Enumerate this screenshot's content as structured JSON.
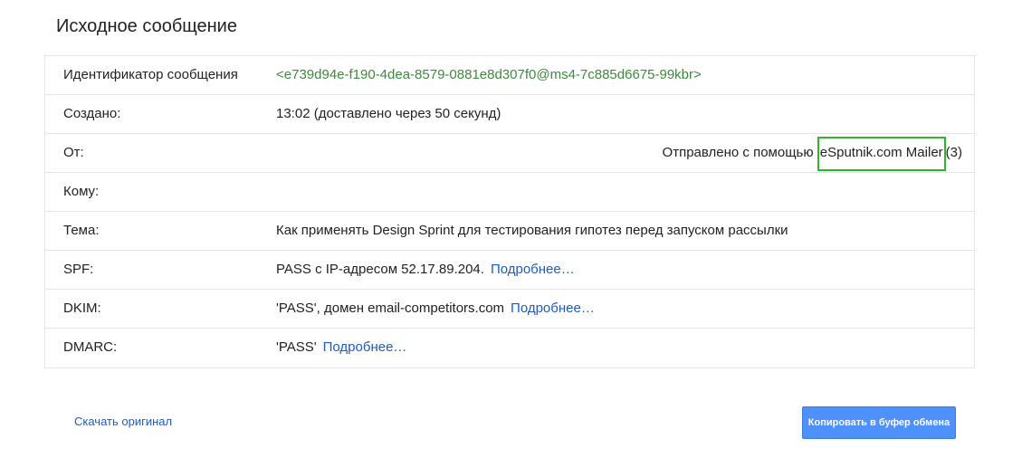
{
  "page": {
    "title": "Исходное сообщение"
  },
  "rows": {
    "message_id": {
      "label": "Идентификатор сообщения",
      "value": "<e739d94e-f190-4dea-8579-0881e8d307f0@ms4-7c885d6675-99kbr>"
    },
    "created": {
      "label": "Создано:",
      "value": "13:02 (доставлено через 50 секунд)"
    },
    "from": {
      "label": "От:",
      "sent_via_prefix": "Отправлено с помощью ",
      "mailer": "eSputnik.com Mailer",
      "count": "(3)"
    },
    "to": {
      "label": "Кому:",
      "value": ""
    },
    "subject": {
      "label": "Тема:",
      "value": "Как применять Design Sprint для тестирования гипотез перед запуском рассылки"
    },
    "spf": {
      "label": "SPF:",
      "value": "PASS с IP-адресом 52.17.89.204.",
      "link": "Подробнее…"
    },
    "dkim": {
      "label": "DKIM:",
      "value": "'PASS', домен email-competitors.com",
      "link": "Подробнее…"
    },
    "dmarc": {
      "label": "DMARC:",
      "value": "'PASS'",
      "link": "Подробнее…"
    }
  },
  "footer": {
    "download_label": "Скачать оригинал",
    "copy_button_label": "Копировать в буфер обмена"
  },
  "colors": {
    "link": "#1a5dc7",
    "message_id": "#3d8a3d",
    "highlight_border": "#2db52d",
    "button_bg": "#4d90fe"
  }
}
